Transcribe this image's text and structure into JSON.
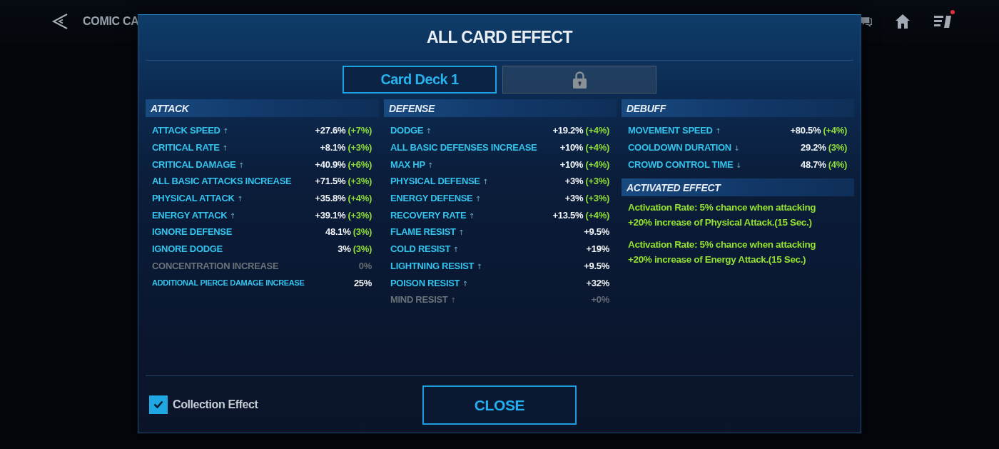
{
  "top_bar": {
    "title": "COMIC CA",
    "icons": [
      {
        "kind": "chat",
        "badge": false
      },
      {
        "kind": "home",
        "badge": false
      },
      {
        "kind": "quests",
        "badge": true
      }
    ]
  },
  "dialog": {
    "title": "ALL CARD EFFECT",
    "tabs": [
      {
        "kind": "deck",
        "label": "Card Deck 1",
        "selected": true
      },
      {
        "kind": "locked",
        "selected": false
      }
    ]
  },
  "columns": [
    {
      "sections": [
        {
          "title": "ATTACK",
          "stats": [
            {
              "label": "ATTACK SPEED",
              "arrow": "↑",
              "value": "+27.6%",
              "bonus": "(+7%)",
              "disabled": false
            },
            {
              "label": "CRITICAL RATE",
              "arrow": "↑",
              "value": "+8.1%",
              "bonus": "(+3%)",
              "disabled": false
            },
            {
              "label": "CRITICAL DAMAGE",
              "arrow": "↑",
              "value": "+40.9%",
              "bonus": "(+6%)",
              "disabled": false
            },
            {
              "label": "ALL BASIC ATTACKS INCREASE",
              "value": "+71.5%",
              "bonus": "(+3%)",
              "disabled": false
            },
            {
              "label": "PHYSICAL ATTACK",
              "arrow": "↑",
              "value": "+35.8%",
              "bonus": "(+4%)",
              "disabled": false
            },
            {
              "label": "ENERGY ATTACK",
              "arrow": "↑",
              "value": "+39.1%",
              "bonus": "(+3%)",
              "disabled": false
            },
            {
              "label": "IGNORE DEFENSE",
              "value": "48.1%",
              "bonus": "(3%)",
              "disabled": false
            },
            {
              "label": "IGNORE DODGE",
              "value": "3%",
              "bonus": "(3%)",
              "disabled": false
            },
            {
              "label": "CONCENTRATION INCREASE",
              "value": "0%",
              "disabled": true
            },
            {
              "label": "ADDITIONAL PIERCE DAMAGE INCREASE",
              "value": "25%",
              "disabled": false
            }
          ]
        }
      ]
    },
    {
      "sections": [
        {
          "title": "DEFENSE",
          "stats": [
            {
              "label": "DODGE",
              "arrow": "↑",
              "value": "+19.2%",
              "bonus": "(+4%)",
              "disabled": false
            },
            {
              "label": "ALL BASIC DEFENSES INCREASE",
              "value": "+10%",
              "bonus": "(+4%)",
              "disabled": false
            },
            {
              "label": "MAX HP",
              "arrow": "↑",
              "value": "+10%",
              "bonus": "(+4%)",
              "disabled": false
            },
            {
              "label": "PHYSICAL DEFENSE",
              "arrow": "↑",
              "value": "+3%",
              "bonus": "(+3%)",
              "disabled": false
            },
            {
              "label": "ENERGY DEFENSE",
              "arrow": "↑",
              "value": "+3%",
              "bonus": "(+3%)",
              "disabled": false
            },
            {
              "label": "RECOVERY RATE",
              "arrow": "↑",
              "value": "+13.5%",
              "bonus": "(+4%)",
              "disabled": false
            },
            {
              "label": "FLAME RESIST",
              "arrow": "↑",
              "value": "+9.5%",
              "disabled": false
            },
            {
              "label": "COLD RESIST",
              "arrow": "↑",
              "value": "+19%",
              "disabled": false
            },
            {
              "label": "LIGHTNING RESIST",
              "arrow": "↑",
              "value": "+9.5%",
              "disabled": false
            },
            {
              "label": "POISON RESIST",
              "arrow": "↑",
              "value": "+32%",
              "disabled": false
            },
            {
              "label": "MIND RESIST",
              "arrow": "↑",
              "value": "+0%",
              "disabled": true
            }
          ]
        }
      ]
    },
    {
      "sections": [
        {
          "title": "DEBUFF",
          "stats": [
            {
              "label": "MOVEMENT SPEED",
              "arrow": "↑",
              "value": "+80.5%",
              "bonus": "(+4%)",
              "disabled": false
            },
            {
              "label": "COOLDOWN DURATION",
              "arrow": "↓",
              "value": "29.2%",
              "bonus": "(3%)",
              "disabled": false
            },
            {
              "label": "CROWD CONTROL TIME",
              "arrow": "↓",
              "value": "48.7%",
              "bonus": "(4%)",
              "disabled": false
            }
          ]
        },
        {
          "title": "ACTIVATED EFFECT",
          "effects": [
            {
              "lines": [
                "Activation Rate: 5% chance when attacking",
                "+20% increase of Physical Attack.(15 Sec.)"
              ]
            },
            {
              "lines": [
                "Activation Rate: 5% chance when attacking",
                "+20% increase of Energy Attack.(15 Sec.)"
              ]
            }
          ]
        }
      ]
    }
  ],
  "footer": {
    "collection_effect": {
      "label": "Collection Effect",
      "checked": true
    },
    "close_button": "CLOSE"
  }
}
